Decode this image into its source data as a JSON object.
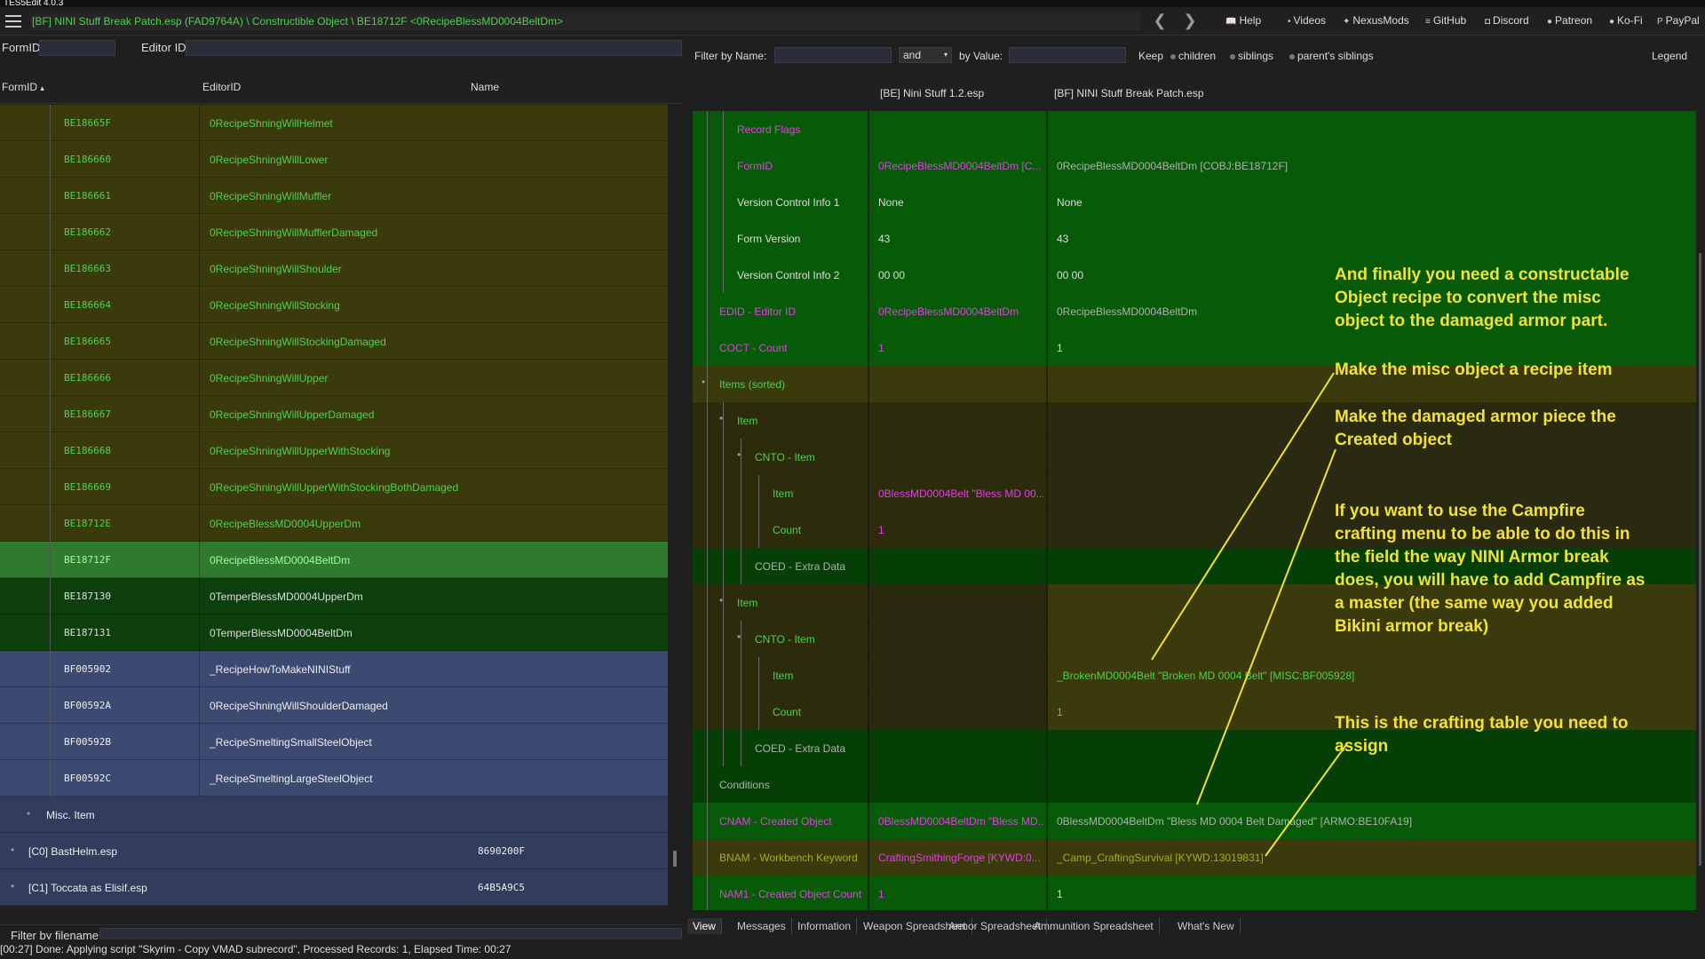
{
  "app_title": "TES5Edit 4.0.3",
  "toolbar": {
    "path": "[BF] NINI Stuff Break Patch.esp (FAD9764A) \\ Constructible Object \\ BE18712F <0RecipeBlessMD0004BeltDm>",
    "back": "❮",
    "forward": "❯",
    "links": [
      "Help",
      "Videos",
      "NexusMods",
      "GitHub",
      "Discord",
      "Patreon",
      "Ko-Fi",
      "PayPal"
    ]
  },
  "left": {
    "formid_label": "FormID",
    "editorid_label": "Editor ID",
    "col_formid": "FormID",
    "col_sort": "▴",
    "col_editorid": "EditorID",
    "col_name": "Name",
    "rows": [
      {
        "fid": "BE18665F",
        "eid": "0RecipeShningWillHelmet",
        "style": "olive"
      },
      {
        "fid": "BE186660",
        "eid": "0RecipeShningWillLower",
        "style": "olive"
      },
      {
        "fid": "BE186661",
        "eid": "0RecipeShningWillMuffler",
        "style": "olive"
      },
      {
        "fid": "BE186662",
        "eid": "0RecipeShningWillMufflerDamaged",
        "style": "olive"
      },
      {
        "fid": "BE186663",
        "eid": "0RecipeShningWillShoulder",
        "style": "olive"
      },
      {
        "fid": "BE186664",
        "eid": "0RecipeShningWillStocking",
        "style": "olive"
      },
      {
        "fid": "BE186665",
        "eid": "0RecipeShningWillStockingDamaged",
        "style": "olive"
      },
      {
        "fid": "BE186666",
        "eid": "0RecipeShningWillUpper",
        "style": "olive"
      },
      {
        "fid": "BE186667",
        "eid": "0RecipeShningWillUpperDamaged",
        "style": "olive"
      },
      {
        "fid": "BE186668",
        "eid": "0RecipeShningWillUpperWithStocking",
        "style": "olive"
      },
      {
        "fid": "BE186669",
        "eid": "0RecipeShningWillUpperWithStockingBothDamaged",
        "style": "olive"
      },
      {
        "fid": "BE18712E",
        "eid": "0RecipeBlessMD0004UpperDm",
        "style": "olive"
      },
      {
        "fid": "BE18712F",
        "eid": "0RecipeBlessMD0004BeltDm",
        "style": "sel"
      },
      {
        "fid": "BE187130",
        "eid": "0TemperBlessMD0004UpperDm",
        "style": "dkgreen"
      },
      {
        "fid": "BE187131",
        "eid": "0TemperBlessMD0004BeltDm",
        "style": "dkgreen"
      },
      {
        "fid": "BF005902",
        "eid": "_RecipeHowToMakeNINIStuff",
        "style": "blue"
      },
      {
        "fid": "BF00592A",
        "eid": "0RecipeShningWillShoulderDamaged",
        "style": "blue"
      },
      {
        "fid": "BF00592B",
        "eid": "_RecipeSmeltingSmallSteelObject",
        "style": "blue"
      },
      {
        "fid": "BF00592C",
        "eid": "_RecipeSmeltingLargeSteelObject",
        "style": "blue"
      }
    ],
    "group_misc": "Misc. Item",
    "plugins": [
      {
        "name": "[C0] BastHelm.esp",
        "id": "8690200F"
      },
      {
        "name": "[C1] Toccata as Elisif.esp",
        "id": "64B5A9C5"
      }
    ],
    "filter_label": "Filter by filename:"
  },
  "right": {
    "filter": {
      "by_name": "Filter by Name:",
      "and": "and",
      "by_value": "by Value:",
      "keep": "Keep",
      "children": "children",
      "siblings": "siblings",
      "parents_siblings": "parent's siblings",
      "legend": "Legend"
    },
    "col_master": "[BE] Nini Stuff 1.2.esp",
    "col_patch": "[BF] NINI Stuff Break Patch.esp",
    "rows": [
      {
        "label": "Record Flags",
        "c2": "",
        "c3": ""
      },
      {
        "label": "FormID",
        "c2": "0RecipeBlessMD0004BeltDm [C...",
        "c3": "0RecipeBlessMD0004BeltDm [COBJ:BE18712F]"
      },
      {
        "label": "Version Control Info 1",
        "c2": "None",
        "c3": "None"
      },
      {
        "label": "Form Version",
        "c2": "43",
        "c3": "43"
      },
      {
        "label": "Version Control Info 2",
        "c2": "00 00",
        "c3": "00 00"
      },
      {
        "label": "EDID - Editor ID",
        "c2": "0RecipeBlessMD0004BeltDm",
        "c3": "0RecipeBlessMD0004BeltDm"
      },
      {
        "label": "COCT - Count",
        "c2": "1",
        "c3": "1"
      },
      {
        "label": "Items (sorted)",
        "c2": "",
        "c3": ""
      },
      {
        "label": "Item",
        "c2": "",
        "c3": ""
      },
      {
        "label": "CNTO - Item",
        "c2": "",
        "c3": ""
      },
      {
        "label": "Item",
        "c2": "0BlessMD0004Belt \"Bless MD 00...",
        "c3": ""
      },
      {
        "label": "Count",
        "c2": "1",
        "c3": ""
      },
      {
        "label": "COED - Extra Data",
        "c2": "",
        "c3": ""
      },
      {
        "label": "Item",
        "c2": "",
        "c3": ""
      },
      {
        "label": "CNTO - Item",
        "c2": "",
        "c3": ""
      },
      {
        "label": "Item",
        "c2": "",
        "c3": "_BrokenMD0004Belt \"Broken MD 0004 Belt\" [MISC:BF005928]"
      },
      {
        "label": "Count",
        "c2": "",
        "c3": "1"
      },
      {
        "label": "COED - Extra Data",
        "c2": "",
        "c3": ""
      },
      {
        "label": "Conditions",
        "c2": "",
        "c3": ""
      },
      {
        "label": "CNAM - Created Object",
        "c2": "0BlessMD0004BeltDm \"Bless MD...",
        "c3": "0BlessMD0004BeltDm \"Bless MD 0004 Belt Damaged\" [ARMO:BE10FA19]"
      },
      {
        "label": "BNAM - Workbench Keyword",
        "c2": "CraftingSmithingForge [KYWD:0...",
        "c3": "_Camp_CraftingSurvival [KYWD:13019831]"
      },
      {
        "label": "NAM1 - Created Object Count",
        "c2": "1",
        "c3": "1"
      }
    ],
    "tabs": [
      "View",
      "Messages",
      "Information",
      "Weapon Spreadsheet",
      "Armor Spreadsheet",
      "Ammunition Spreadsheet",
      "What's New"
    ]
  },
  "status": "[00:27] Done: Applying script \"Skyrim - Copy VMAD subrecord\", Processed Records: 1, Elapsed Time: 00:27",
  "notes": {
    "n1": [
      "And finally you need a constructable",
      "Object recipe to convert the misc",
      "object to the damaged armor part."
    ],
    "n2": [
      "Make the misc object a recipe item"
    ],
    "n3": [
      "Make the damaged armor piece the",
      "Created object"
    ],
    "n4": [
      "If you want to use the Campfire",
      "crafting menu to be able to do this in",
      "the field the way NINI Armor break",
      "does, you will have to add Campfire as",
      "a master (the same way you added",
      "Bikini armor break)"
    ],
    "n5": [
      "This is the crafting table you need to",
      "assign"
    ]
  }
}
